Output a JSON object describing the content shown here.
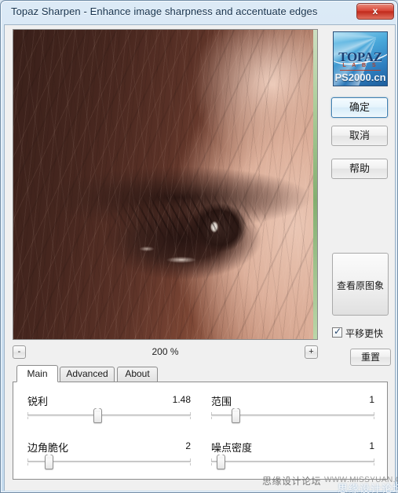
{
  "window": {
    "title": "Topaz Sharpen - Enhance image sharpness and accentuate edges",
    "close_label": "x",
    "close_icon": "close-icon"
  },
  "preview": {
    "description": "Close-up photograph of a human eye with long brown hair falling across the face",
    "zoom_out_label": "-",
    "zoom_in_label": "+",
    "zoom_level": "200 %"
  },
  "logo": {
    "brand": "TOPAZ",
    "sub": "L A B S",
    "watermark": "PS2000.cn"
  },
  "actions": {
    "ok_label": "确定",
    "cancel_label": "取消",
    "help_label": "帮助",
    "view_original_label": "查看原图象",
    "faster_pan_label": "平移更快",
    "faster_pan_checked": true,
    "reset_label": "重置"
  },
  "tabs": [
    {
      "label": "Main",
      "active": true
    },
    {
      "label": "Advanced",
      "active": false
    },
    {
      "label": "About",
      "active": false
    }
  ],
  "sliders": [
    {
      "label": "锐利",
      "value": "1.48",
      "percent": 43
    },
    {
      "label": "范围",
      "value": "1",
      "percent": 15
    },
    {
      "label": "边角脆化",
      "value": "2",
      "percent": 13
    },
    {
      "label": "噪点密度",
      "value": "1",
      "percent": 6
    }
  ],
  "watermarks": {
    "forum": "思缘设计论坛",
    "url": "WWW.MISSYUAN.COM",
    "ghost": "思缘设计论坛"
  },
  "colors": {
    "accent": "#3c7fb1",
    "title_text": "#16324d",
    "close_red": "#c1291c",
    "panel_bg": "#f0f0f0"
  }
}
